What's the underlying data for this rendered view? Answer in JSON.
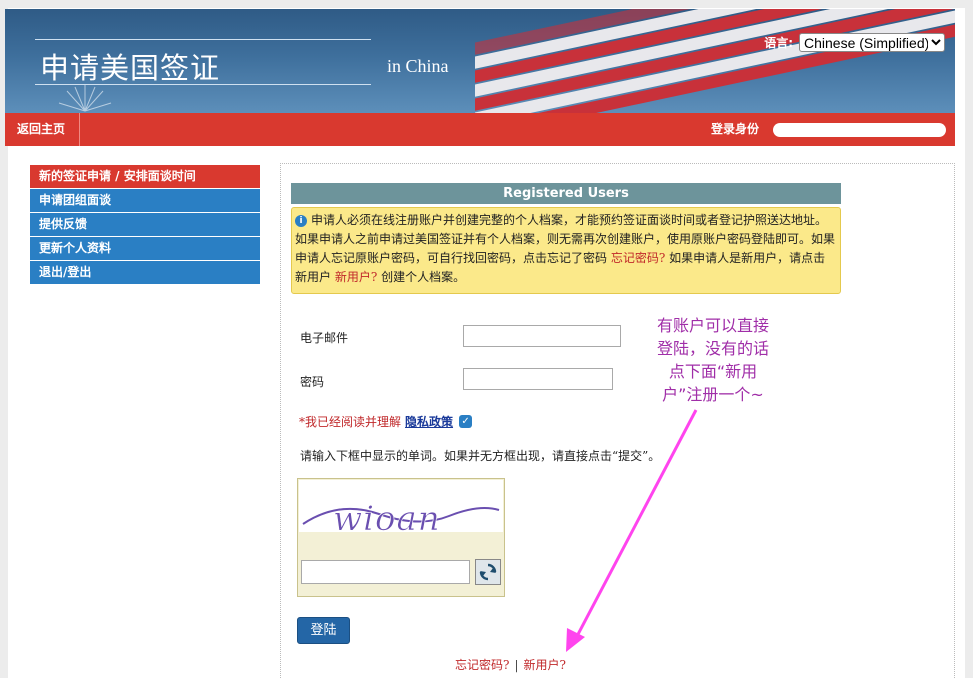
{
  "header": {
    "site_title": "申请美国签证",
    "sub_title": "in China",
    "language_label": "语言:",
    "language_selected": "Chinese (Simplified)"
  },
  "nav": {
    "home_label": "返回主页",
    "login_id_label": "登录身份"
  },
  "sidebar": {
    "items": [
      {
        "label": "新的签证申请 / 安排面谈时间",
        "active": true
      },
      {
        "label": "申请团组面谈",
        "active": false
      },
      {
        "label": "提供反馈",
        "active": false
      },
      {
        "label": "更新个人资料",
        "active": false
      },
      {
        "label": "退出/登出",
        "active": false
      }
    ]
  },
  "main": {
    "section_title": "Registered Users",
    "notice": {
      "text_1": "申请人必须在线注册账户并创建完整的个人档案，才能预约签证面谈时间或者登记护照送达地址。如果申请人之前申请过美国签证并有个人档案，则无需再次创建账户，使用原账户密码登陆即可。如果申请人忘记原账户密码，可自行找回密码，点击忘记了密码 ",
      "forgot_link": "忘记密码?",
      "text_2": " 如果申请人是新用户，请点击新用户 ",
      "new_user_link": "新用户?",
      "text_3": " 创建个人档案。"
    },
    "email_label": "电子邮件",
    "email_value": "",
    "password_label": "密码",
    "password_value": "",
    "privacy_required": "*我已经阅读并理解",
    "privacy_link": "隐私政策",
    "privacy_checked": true,
    "captcha_hint": "请输入下框中显示的单词。如果并无方框出现，请直接点击“提交”。",
    "captcha_word": "wioan",
    "captcha_value": "",
    "login_button": "登陆",
    "forgot_password_link": "忘记密码?",
    "link_separator": "|",
    "new_user_link": "新用户?"
  },
  "annotation": {
    "lines": [
      "有账户可以直接",
      "登陆，没有的话",
      "点下面“新用",
      "户”注册一个~"
    ],
    "color": "#a02ea8",
    "arrow_color": "#ff44ee"
  }
}
